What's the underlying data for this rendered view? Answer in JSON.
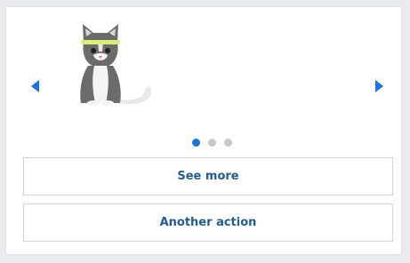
{
  "carousel": {
    "slide_image": "cat-sitting-with-headband-illustration",
    "prev_icon": "chevron-left-icon",
    "next_icon": "chevron-right-icon",
    "active_slide": 1,
    "slide_count": 3
  },
  "actions": {
    "see_more_label": "See more",
    "another_action_label": "Another action"
  },
  "colors": {
    "accent": "#1a73e8",
    "button_text": "#1f5c99",
    "arrow": "#1a73e8",
    "inactive_dot": "#c8c8c8"
  }
}
